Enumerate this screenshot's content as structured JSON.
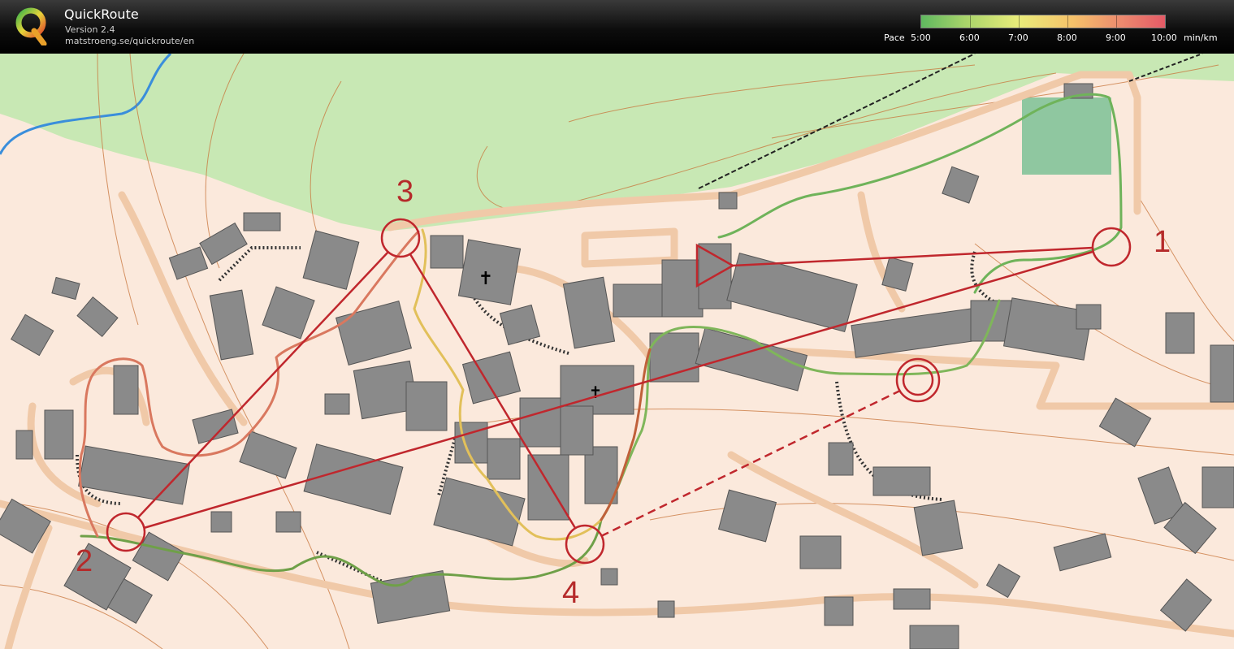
{
  "app": {
    "title": "QuickRoute",
    "version": "Version 2.4",
    "url": "matstroeng.se/quickroute/en"
  },
  "legend": {
    "label": "Pace",
    "ticks": [
      "5:00",
      "6:00",
      "7:00",
      "8:00",
      "9:00",
      "10:00"
    ],
    "unit": "min/km",
    "colors": [
      "#5fb85f",
      "#e9ec7a",
      "#e45a66"
    ]
  },
  "course": {
    "control_numbers": [
      "1",
      "2",
      "3",
      "4"
    ],
    "color": "#c0272d"
  },
  "map_colors": {
    "open_land": "#c8e8b4",
    "settlement": "#fbe9dc",
    "road": "#f0c9a8",
    "building": "#8a8a8a",
    "contour": "#c8743a",
    "water": "#3a8edb"
  }
}
